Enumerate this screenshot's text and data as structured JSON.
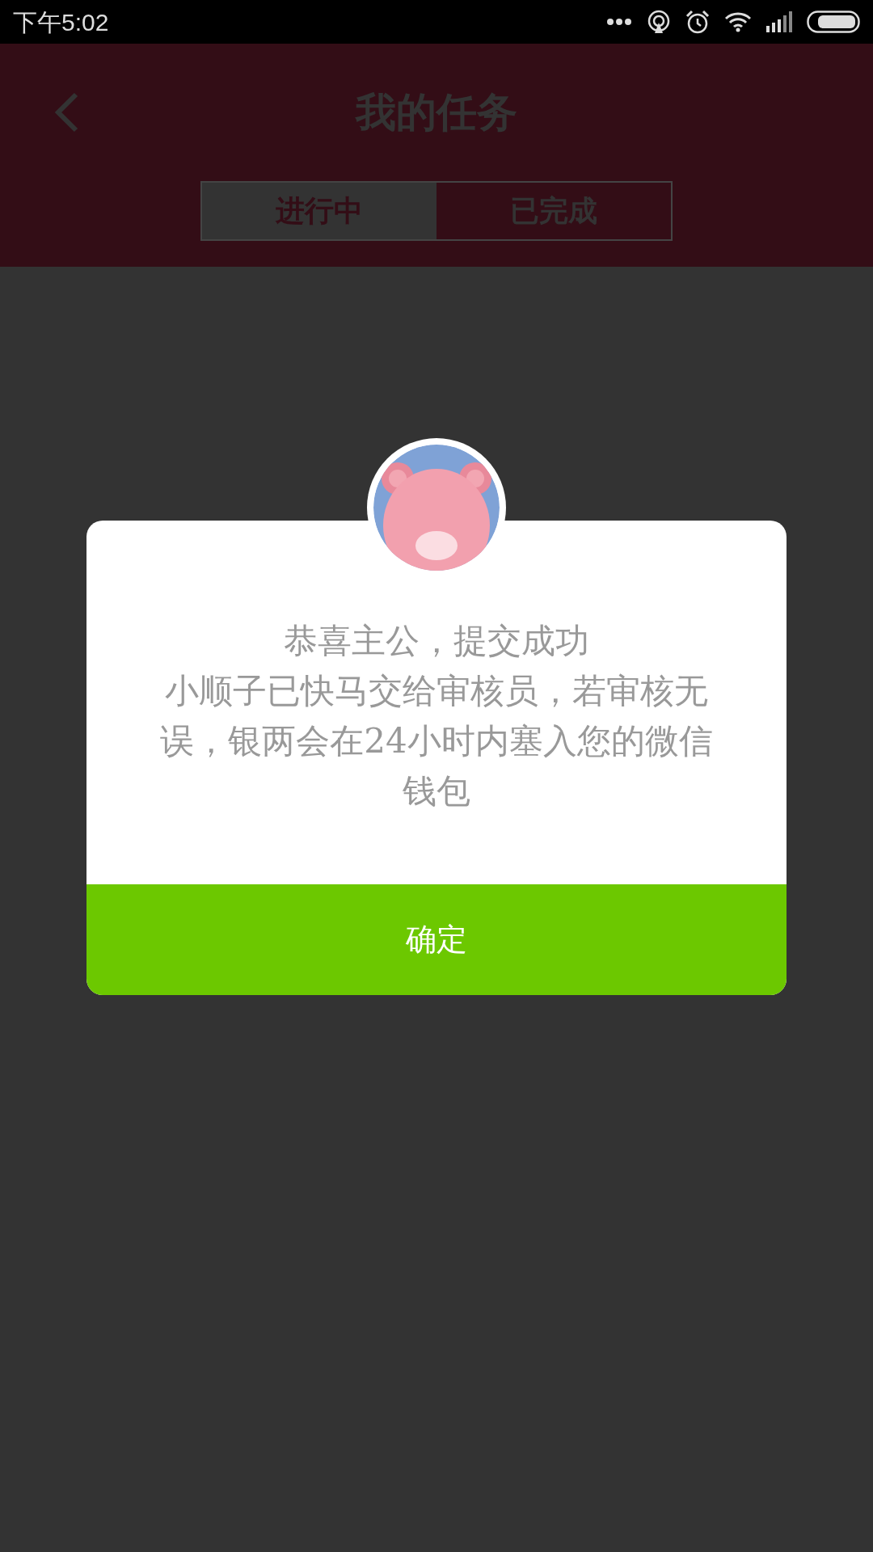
{
  "status_bar": {
    "time": "下午5:02"
  },
  "header": {
    "title": "我的任务"
  },
  "tabs": [
    {
      "label": "进行中",
      "selected": true
    },
    {
      "label": "已完成",
      "selected": false
    }
  ],
  "dialog": {
    "title": "恭喜主公，提交成功",
    "message": "小顺子已快马交给审核员，若审核无误，银两会在24小时内塞入您的微信钱包",
    "button": "确定"
  }
}
